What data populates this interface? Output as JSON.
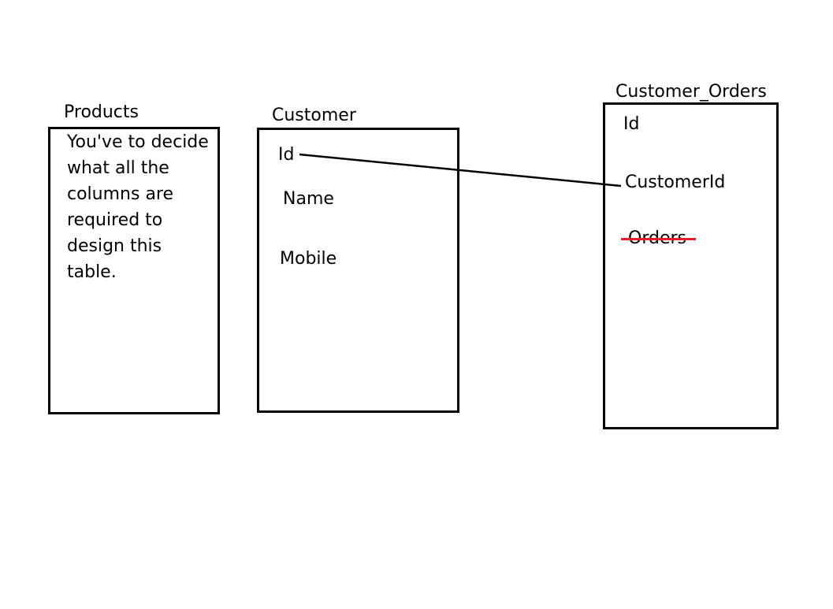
{
  "tables": {
    "products": {
      "title": "Products",
      "description": "You've to decide what all the columns are required to design this table."
    },
    "customer": {
      "title": "Customer",
      "fields": [
        "Id",
        "Name",
        "Mobile"
      ]
    },
    "customer_orders": {
      "title": "Customer_Orders",
      "fields": [
        "Id",
        "CustomerId",
        "Orders"
      ],
      "struck_field": "Orders"
    }
  },
  "relationship": {
    "from": "Customer.Id",
    "to": "Customer_Orders.CustomerId"
  },
  "colors": {
    "line": "#000000",
    "strike": "#e0202a"
  }
}
